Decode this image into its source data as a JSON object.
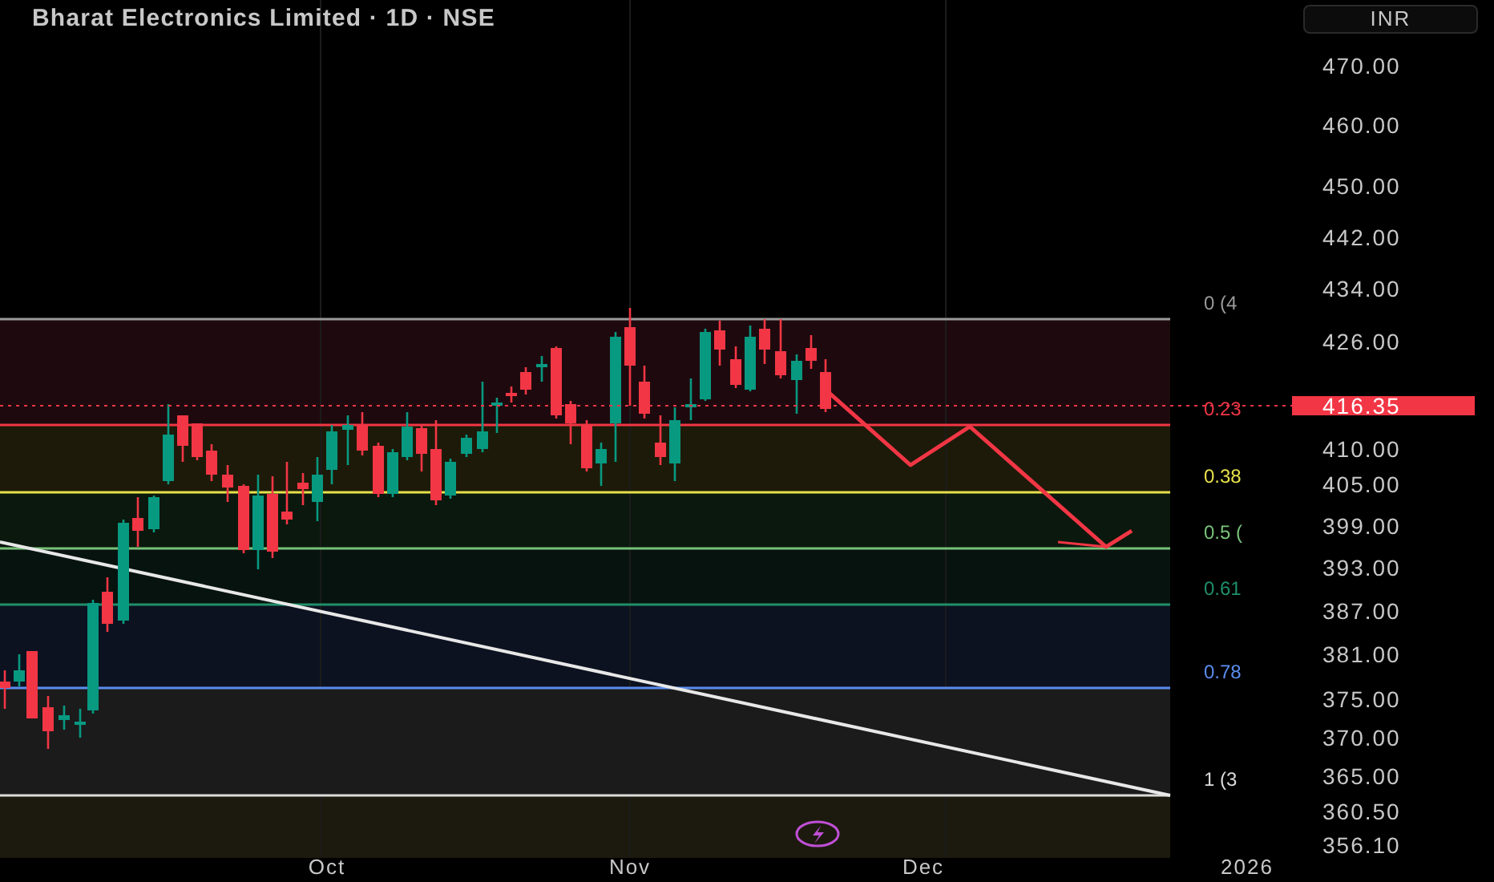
{
  "chart": {
    "title": "Bharat Electronics Limited · 1D · NSE",
    "currency_button": "INR",
    "current_price": "416.35",
    "price_axis": [
      "470.00",
      "460.00",
      "450.00",
      "442.00",
      "434.00",
      "426.00",
      "410.00",
      "405.00",
      "399.00",
      "393.00",
      "387.00",
      "381.00",
      "375.00",
      "370.00",
      "365.00",
      "360.50",
      "356.10"
    ],
    "fib_levels": [
      {
        "label": "0 (4",
        "color": "#9a9a9a"
      },
      {
        "label": "0.23",
        "color": "#f23645"
      },
      {
        "label": "0.38",
        "color": "#e6e04b"
      },
      {
        "label": "0.5 (",
        "color": "#78c27a"
      },
      {
        "label": "0.61",
        "color": "#1f8f6a"
      },
      {
        "label": "0.78",
        "color": "#5b8def"
      },
      {
        "label": "1 (3",
        "color": "#dcdcdc"
      }
    ],
    "time_axis": [
      "Oct",
      "Nov",
      "Dec",
      "2026"
    ]
  }
}
